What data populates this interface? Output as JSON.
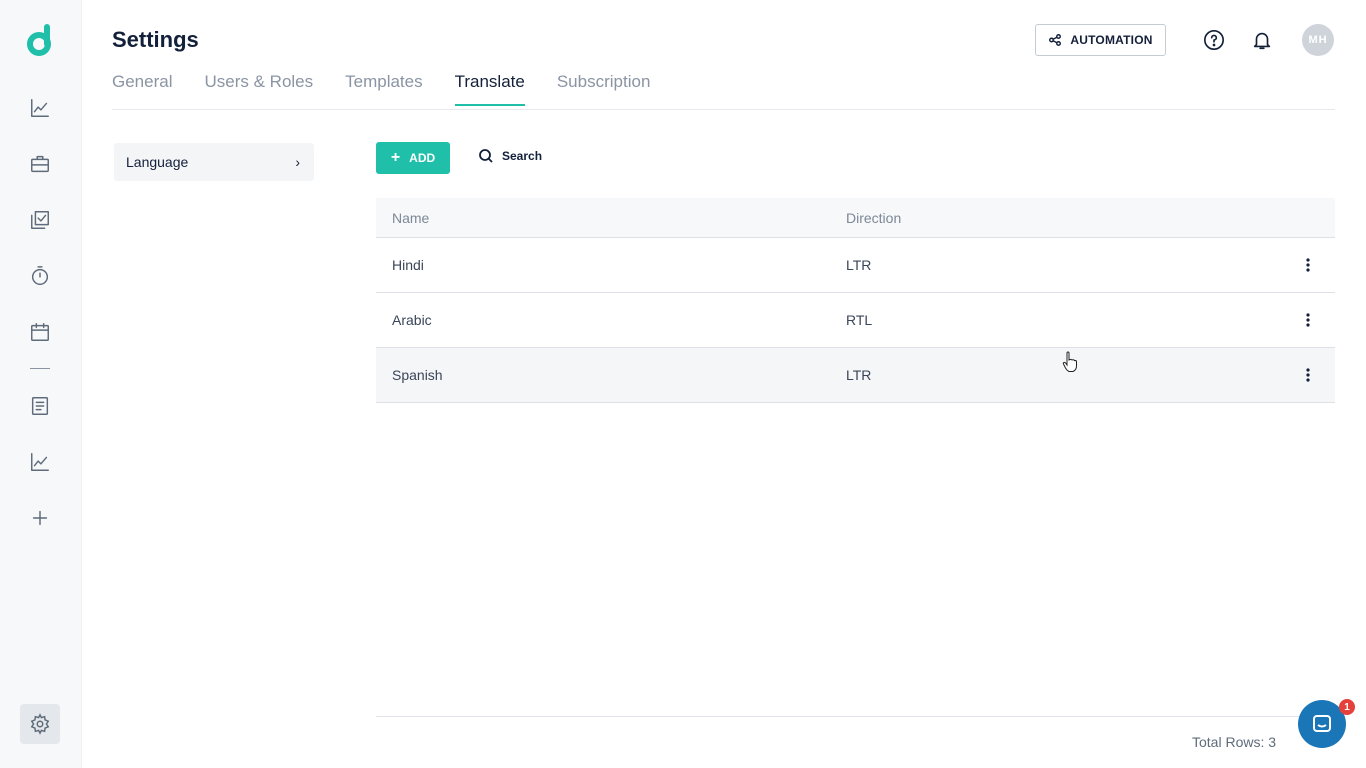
{
  "app": {
    "brand_color": "#1fbfa9"
  },
  "rail": {
    "items": [
      {
        "icon": "analytics-icon"
      },
      {
        "icon": "briefcase-icon"
      },
      {
        "icon": "tasks-icon"
      },
      {
        "icon": "timer-icon"
      },
      {
        "icon": "calendar-icon"
      },
      {
        "icon": "document-icon"
      },
      {
        "icon": "reports-icon"
      },
      {
        "icon": "plus-icon"
      }
    ],
    "settings_icon": "gear-icon"
  },
  "header": {
    "title": "Settings",
    "automation_label": "AUTOMATION",
    "avatar_initials": "MH"
  },
  "tabs": [
    {
      "label": "General",
      "active": false
    },
    {
      "label": "Users & Roles",
      "active": false
    },
    {
      "label": "Templates",
      "active": false
    },
    {
      "label": "Translate",
      "active": true
    },
    {
      "label": "Subscription",
      "active": false
    }
  ],
  "side_menu": {
    "item_label": "Language",
    "chevron": "›"
  },
  "toolbar": {
    "add_label": "ADD",
    "add_plus": "+",
    "search_label": "Search"
  },
  "table": {
    "columns": [
      "Name",
      "Direction"
    ],
    "rows": [
      {
        "name": "Hindi",
        "direction": "LTR"
      },
      {
        "name": "Arabic",
        "direction": "RTL"
      },
      {
        "name": "Spanish",
        "direction": "LTR"
      }
    ]
  },
  "footer": {
    "total_rows": "Total Rows: 3"
  },
  "chat": {
    "badge_count": "1"
  }
}
